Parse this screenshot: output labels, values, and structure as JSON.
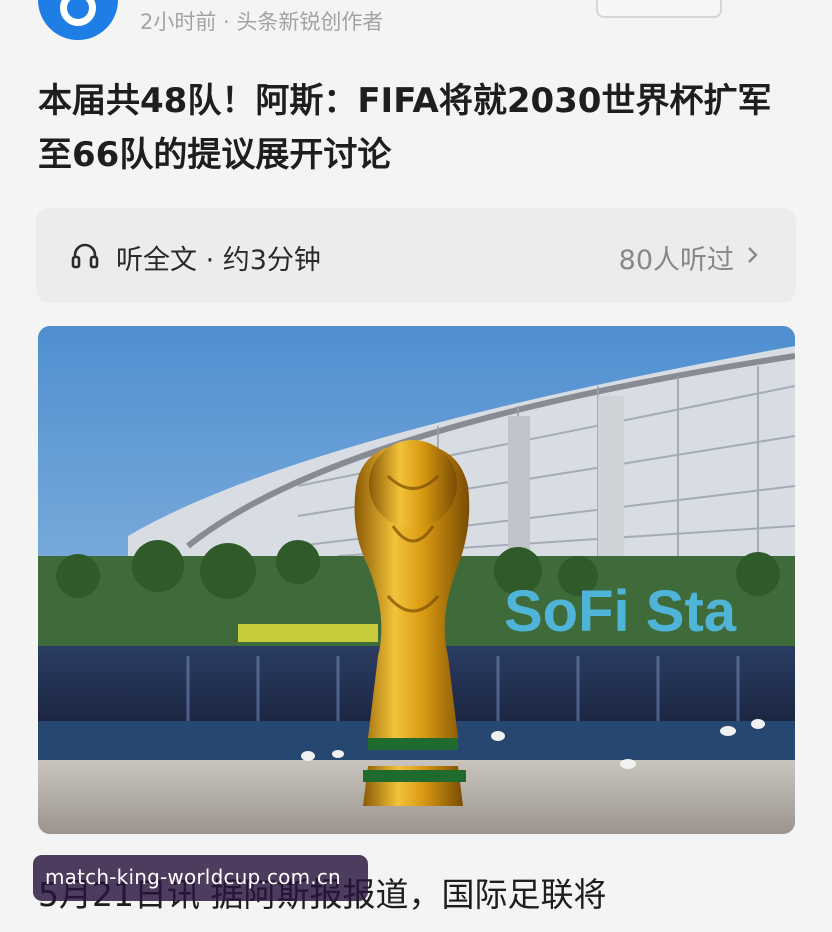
{
  "header": {
    "meta": "2小时前 · 头条新锐创作者",
    "follow_label": ""
  },
  "article": {
    "headline": "本届共48队！阿斯：FIFA将就2030世界杯扩军至66队的提议展开讨论",
    "listen": {
      "label": "听全文 · 约3分钟",
      "count": "80人听过"
    },
    "photo": {
      "sign_text": "SoFi Sta"
    },
    "body_first_line": "5月21日讯 据阿斯报报道，国际足联将"
  },
  "watermark": {
    "text": "match-king-worldcup.com.cn"
  },
  "colors": {
    "brand": "#1f7de6",
    "meta_gray": "#a3a3a3",
    "listen_bg": "#ececec"
  },
  "icons": [
    "avatar-logo-icon",
    "headphone-icon",
    "chevron-right-icon"
  ]
}
